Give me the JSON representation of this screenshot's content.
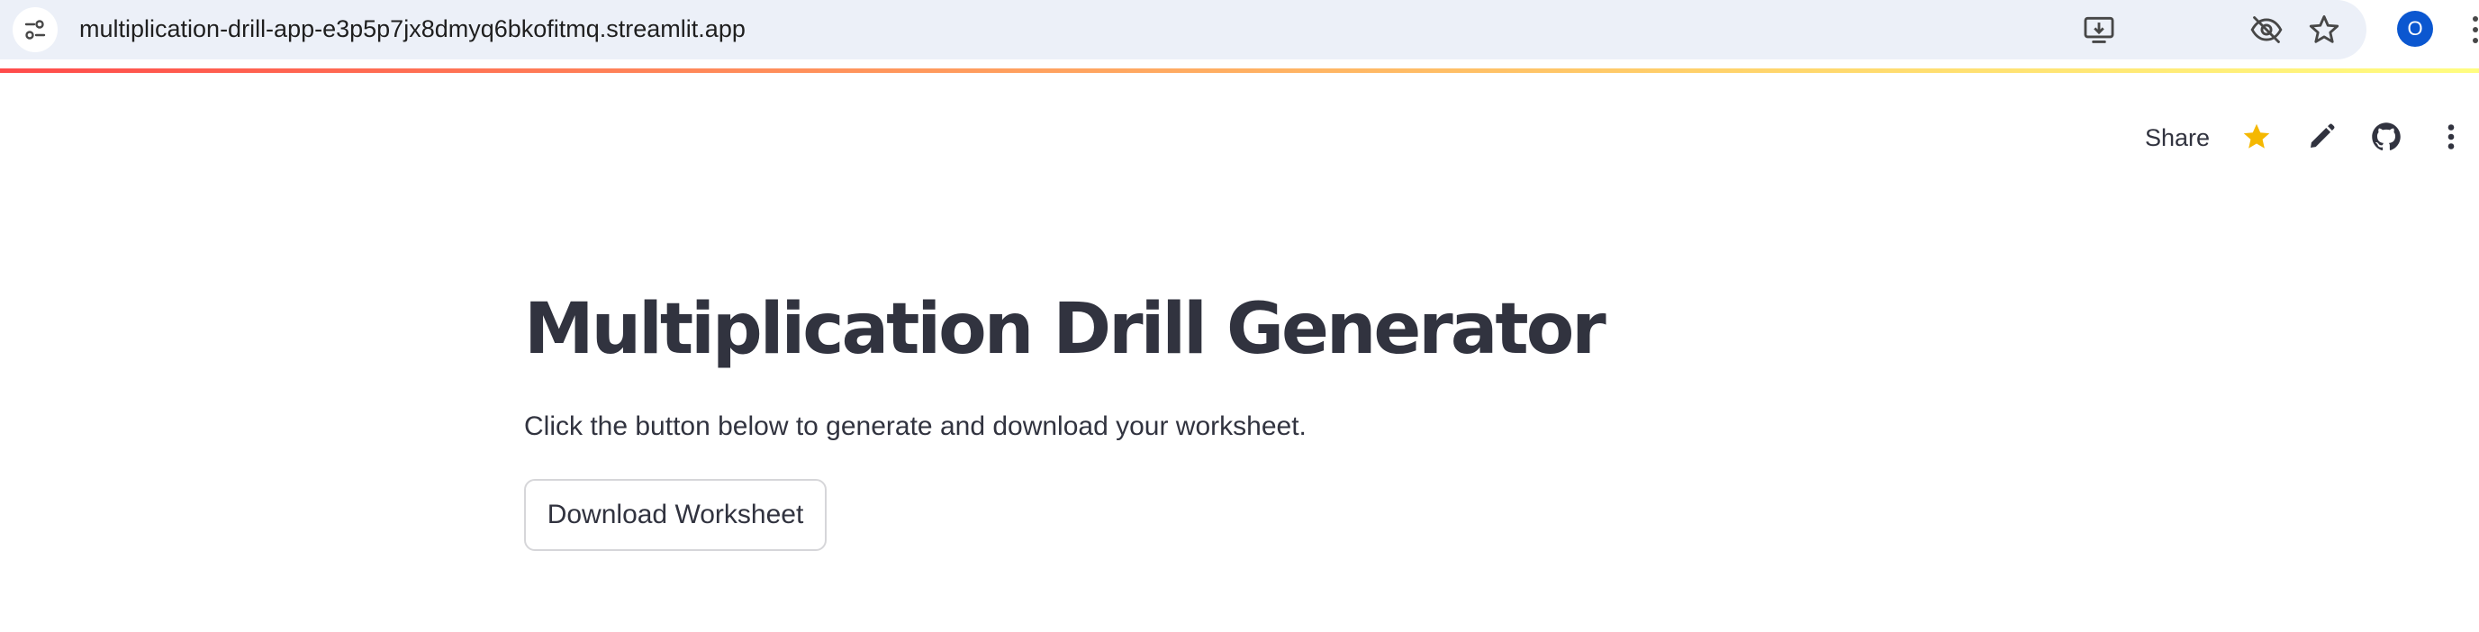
{
  "browser": {
    "url": "multiplication-drill-app-e3p5p7jx8dmyq6bkofitmq.streamlit.app",
    "icons": [
      "site-info-icon",
      "install-app-icon",
      "eye-off-icon",
      "bookmark-star-icon",
      "kebab-menu-icon"
    ],
    "profile_initial": "O",
    "profile_color": "#0b57d0"
  },
  "toolbar": {
    "share_label": "Share",
    "icons": [
      "star-icon",
      "pencil-icon",
      "github-icon",
      "more-vert-icon"
    ],
    "star_color": "#f5b800"
  },
  "main": {
    "title": "Multiplication Drill Generator",
    "caption": "Click the button below to generate and download your worksheet.",
    "download_button_label": "Download Worksheet"
  },
  "theme": {
    "text_color": "#31333f",
    "decoration_gradient": [
      "#ff4b4b",
      "#fffd80"
    ]
  }
}
